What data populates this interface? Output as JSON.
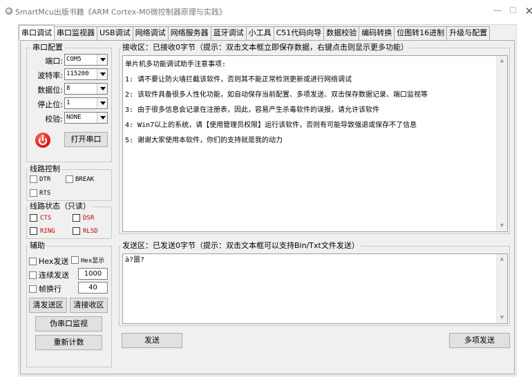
{
  "window": {
    "title": "SmartMcu出版书籍《ARM Cortex-M0微控制器原理与实践》",
    "min_glyph": "—",
    "close_glyph": "✕"
  },
  "tabs": [
    {
      "label": "串口调试",
      "active": true
    },
    {
      "label": "串口监视器"
    },
    {
      "label": "USB调试"
    },
    {
      "label": "网络调试"
    },
    {
      "label": "网络服务器"
    },
    {
      "label": "蓝牙调试"
    },
    {
      "label": "小工具"
    },
    {
      "label": "C51代码向导"
    },
    {
      "label": "数据校验"
    },
    {
      "label": "编码转换"
    },
    {
      "label": "位图转16进制"
    },
    {
      "label": "升级与配置"
    }
  ],
  "serial_config": {
    "legend": "串口配置",
    "port_label": "端口:",
    "port_value": "COM5",
    "baud_label": "波特率:",
    "baud_value": "115200",
    "databits_label": "数据位:",
    "databits_value": "8",
    "stopbits_label": "停止位:",
    "stopbits_value": "1",
    "parity_label": "校验:",
    "parity_value": "NONE",
    "open_button": "打开串口",
    "power_color": "#e0201a"
  },
  "line_control": {
    "legend": "线路控制",
    "dtr": "DTR",
    "break": "BREAK",
    "rts": "RTS"
  },
  "line_status": {
    "legend": "线路状态（只读）",
    "cts": "CTS",
    "dsr": "DSR",
    "ring": "RING",
    "rlsd": "RLSD",
    "status_color": "#c00000"
  },
  "aux": {
    "legend": "辅助",
    "hex_send": "Hex发送",
    "hex_show": "Hex显示",
    "continuous_send": "连续发送",
    "interval_value": "1000",
    "frame_newline": "帧换行",
    "frame_value": "40",
    "clear_send": "清发送区",
    "clear_recv": "清接收区",
    "pseudo_monitor": "伪串口监视",
    "reset_count": "重新计数"
  },
  "recv": {
    "legend": "接收区：已接收0字节（提示：双击文本框立即保存数据，右键点击则显示更多功能）",
    "lines": [
      "",
      "单片机多功能调试助手注意事项:",
      "1: 请不要让防火墙拦截该软件，否则其不能正常检测更新或进行网络调试",
      "2: 该软件具备很多人性化功能，如自动保存当前配置、多项发送、双击保存数据记录、端口监视等",
      "3: 由于很多信息会记录在注册表，因此，容易产生杀毒软件的误报，请允许该软件",
      "4: Win7以上的系统，请【使用管理员权限】运行该软件，否则有可能导致强退或保存不了信息",
      "5: 谢谢大家使用本软件，你们的支持就是我的动力"
    ]
  },
  "send": {
    "legend": "发送区：已发送0字节（提示：双击文本框可以支持Bin/Txt文件发送）",
    "content": "à?噐?",
    "send_button": "发送",
    "multi_send_button": "多项发送"
  },
  "scroll": {
    "up": "▲",
    "down": "▼"
  }
}
